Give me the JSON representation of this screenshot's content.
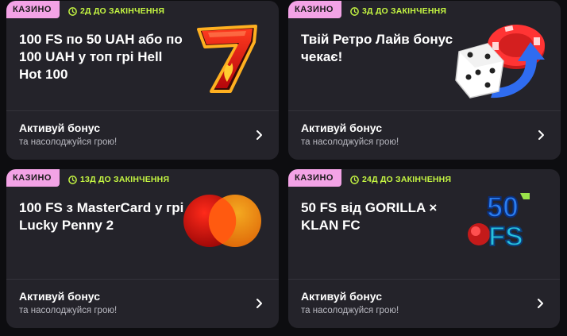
{
  "cards": [
    {
      "tag": "КАЗИНО",
      "timer": "2Д ДО ЗАКІНЧЕННЯ",
      "title": "100 FS по 50 UAH або по 100 UAH у топ грі Hell Hot 100",
      "cta_title": "Активуй бонус",
      "cta_sub": "та насолоджуйся грою!",
      "image": "lucky-seven-icon"
    },
    {
      "tag": "КАЗИНО",
      "timer": "3Д ДО ЗАКІНЧЕННЯ",
      "title": "Твій Ретро Лайв бонус чекає!",
      "cta_title": "Активуй бонус",
      "cta_sub": "та насолоджуйся грою!",
      "image": "dice-chip-icon"
    },
    {
      "tag": "КАЗИНО",
      "timer": "13Д ДО ЗАКІНЧЕННЯ",
      "title": "100 FS з MasterCard у грі Lucky Penny 2",
      "cta_title": "Активуй бонус",
      "cta_sub": "та насолоджуйся грою!",
      "image": "mastercard-logo"
    },
    {
      "tag": "КАЗИНО",
      "timer": "24Д ДО ЗАКІНЧЕННЯ",
      "title": "50 FS від GORILLA × KLAN FC",
      "cta_title": "Активуй бонус",
      "cta_sub": "та насолоджуйся грою!",
      "image": "50-fs-badge",
      "art_text": {
        "top": "50",
        "bottom": "FS"
      }
    }
  ],
  "colors": {
    "tag_bg": "#f3a3e6",
    "timer": "#c4f542",
    "card_bg": "#24232a",
    "page_bg": "#0d0d10"
  }
}
